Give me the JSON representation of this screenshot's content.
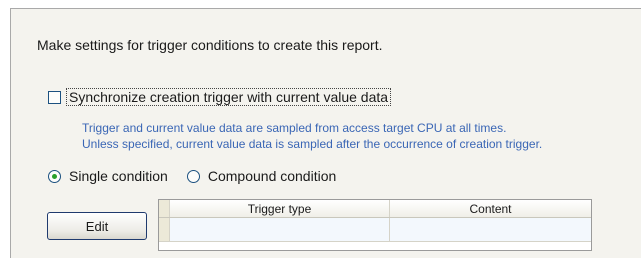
{
  "instruction": "Make settings for trigger conditions to create this report.",
  "sync_checkbox": {
    "label": "Synchronize creation trigger with current value data",
    "checked": false
  },
  "notes": [
    "Trigger and current value data are sampled from access target CPU at all times.",
    "Unless specified, current value data is sampled after the occurrence of creation trigger."
  ],
  "condition": {
    "options": [
      {
        "label": "Single condition",
        "selected": true
      },
      {
        "label": "Compound condition",
        "selected": false
      }
    ]
  },
  "edit_button": {
    "label": "Edit"
  },
  "table": {
    "columns": [
      "Trigger type",
      "Content"
    ]
  },
  "colors": {
    "note_text": "#3a66b5",
    "radio_selected": "#2aa02a",
    "panel_bg": "#f4f3ee"
  }
}
